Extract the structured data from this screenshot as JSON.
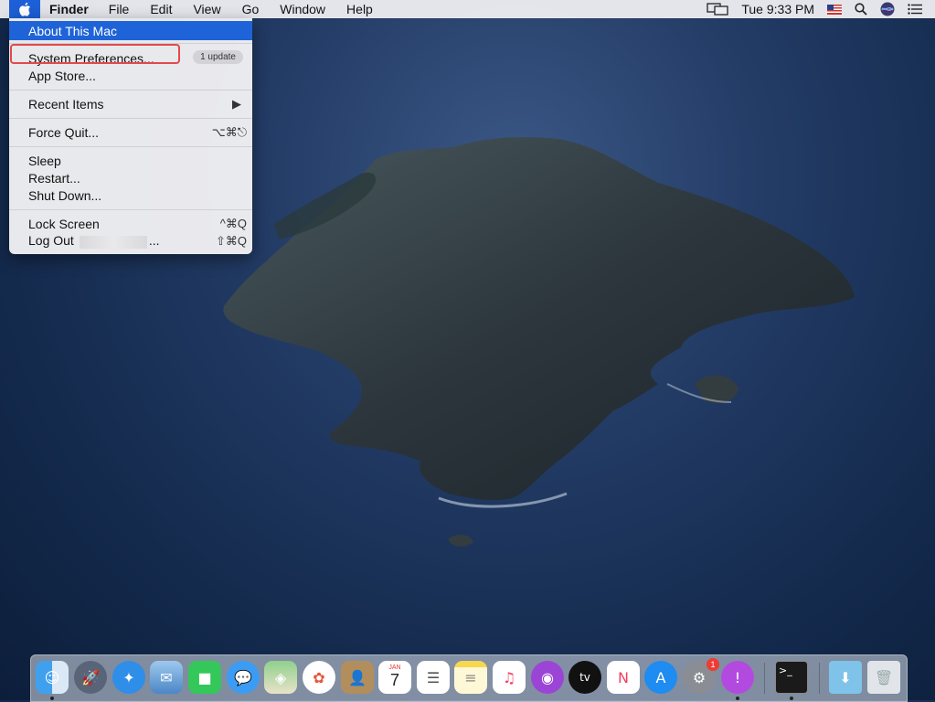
{
  "menubar": {
    "app_name": "Finder",
    "menus": [
      "File",
      "Edit",
      "View",
      "Go",
      "Window",
      "Help"
    ],
    "clock": "Tue 9:33 PM"
  },
  "apple_menu": {
    "about": "About This Mac",
    "system_preferences": "System Preferences...",
    "update_badge": "1 update",
    "app_store": "App Store...",
    "recent_items": "Recent Items",
    "force_quit": "Force Quit...",
    "force_quit_shortcut": "⌥⌘⎋",
    "sleep": "Sleep",
    "restart": "Restart...",
    "shut_down": "Shut Down...",
    "lock_screen": "Lock Screen",
    "lock_screen_shortcut": "^⌘Q",
    "log_out": "Log Out",
    "log_out_suffix": "...",
    "log_out_shortcut": "⇧⌘Q"
  },
  "dock": {
    "calendar_month": "JAN",
    "calendar_day": "7",
    "system_prefs_badge": "1",
    "apps": [
      "finder-icon",
      "launchpad-icon",
      "safari-icon",
      "mail-icon",
      "facetime-icon",
      "messages-icon",
      "maps-icon",
      "photos-icon",
      "contacts-icon",
      "calendar-icon",
      "reminders-icon",
      "notes-icon",
      "music-icon",
      "podcasts-icon",
      "tv-icon",
      "news-icon",
      "app-store-icon",
      "system-preferences-icon",
      "feedback-assistant-icon",
      "terminal-icon",
      "downloads-folder-icon",
      "trash-icon"
    ]
  },
  "colors": {
    "highlight": "#1f63d8",
    "annotation": "#e24a4a"
  }
}
